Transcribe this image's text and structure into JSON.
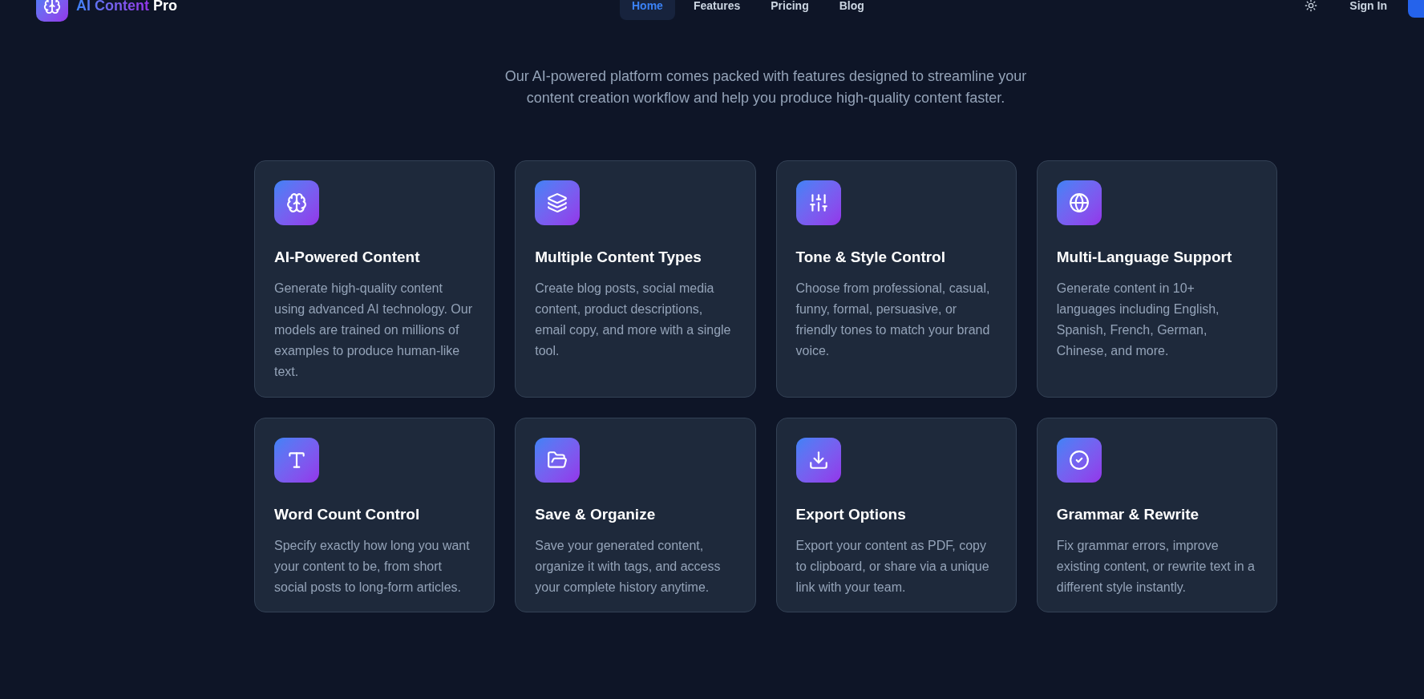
{
  "brand": {
    "name": "AI Content",
    "suffix": "Pro"
  },
  "nav": [
    {
      "label": "Home",
      "selected": true
    },
    {
      "label": "Features",
      "selected": false
    },
    {
      "label": "Pricing",
      "selected": false
    },
    {
      "label": "Blog",
      "selected": false
    }
  ],
  "sign_in": "Sign In",
  "subtitle": "Our AI-powered platform comes packed with features designed to streamline your content creation workflow and help you produce high-quality content faster.",
  "features": [
    {
      "title": "AI-Powered Content",
      "text": "Generate high-quality content using advanced AI technology. Our models are trained on millions of examples to produce human-like text."
    },
    {
      "title": "Multiple Content Types",
      "text": "Create blog posts, social media content, product descriptions, email copy, and more with a single tool."
    },
    {
      "title": "Tone & Style Control",
      "text": "Choose from professional, casual, funny, formal, persuasive, or friendly tones to match your brand voice."
    },
    {
      "title": "Multi-Language Support",
      "text": "Generate content in 10+ languages including English, Spanish, French, German, Chinese, and more."
    },
    {
      "title": "Word Count Control",
      "text": "Specify exactly how long you want your content to be, from short social posts to long-form articles."
    },
    {
      "title": "Save & Organize",
      "text": "Save your generated content, organize it with tags, and access your complete history anytime."
    },
    {
      "title": "Export Options",
      "text": "Export your content as PDF, copy to clipboard, or share via a unique link with your team."
    },
    {
      "title": "Grammar & Rewrite",
      "text": "Fix grammar errors, improve existing content, or rewrite text in a different style instantly."
    }
  ]
}
